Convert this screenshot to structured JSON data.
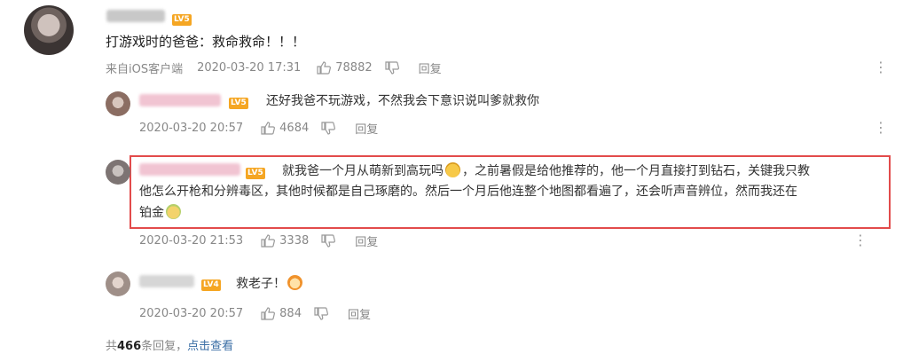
{
  "main_comment": {
    "badge": "LV5",
    "text": "打游戏时的爸爸：救命救命！！！",
    "source": "来自iOS客户端",
    "time": "2020-03-20 17:31",
    "likes": "78882",
    "reply_label": "回复"
  },
  "replies": [
    {
      "badge": "LV5",
      "text": "还好我爸不玩游戏，不然我会下意识说叫爹就救你",
      "time": "2020-03-20 20:57",
      "likes": "4684",
      "reply_label": "回复"
    },
    {
      "badge": "LV5",
      "text_line1a": "就我爸一个月从萌新到高玩吗",
      "text_line1b": "，之前暑假是给他推荐的，他一个月直接打到钻石，关键我只教",
      "text_line2": "他怎么开枪和分辨毒区，其他时候都是自己琢磨的。然后一个月后他连整个地图都看遍了，还会听声音辨位，然而我还在",
      "text_line3": "铂金",
      "time": "2020-03-20 21:53",
      "likes": "3338",
      "reply_label": "回复",
      "highlight_color": "#e24b4b"
    },
    {
      "badge": "LV4",
      "text": "救老子！",
      "time": "2020-03-20 20:57",
      "likes": "884",
      "reply_label": "回复"
    }
  ],
  "footer": {
    "prefix": "共",
    "count": "466",
    "suffix": "条回复，",
    "link": "点击查看"
  },
  "icons": {
    "like": "thumb-up-icon",
    "dislike": "thumb-down-icon",
    "more": "more-vertical-icon"
  },
  "colors": {
    "badge": "#f5a623",
    "link": "#3a6ea5",
    "meta": "#888888"
  }
}
